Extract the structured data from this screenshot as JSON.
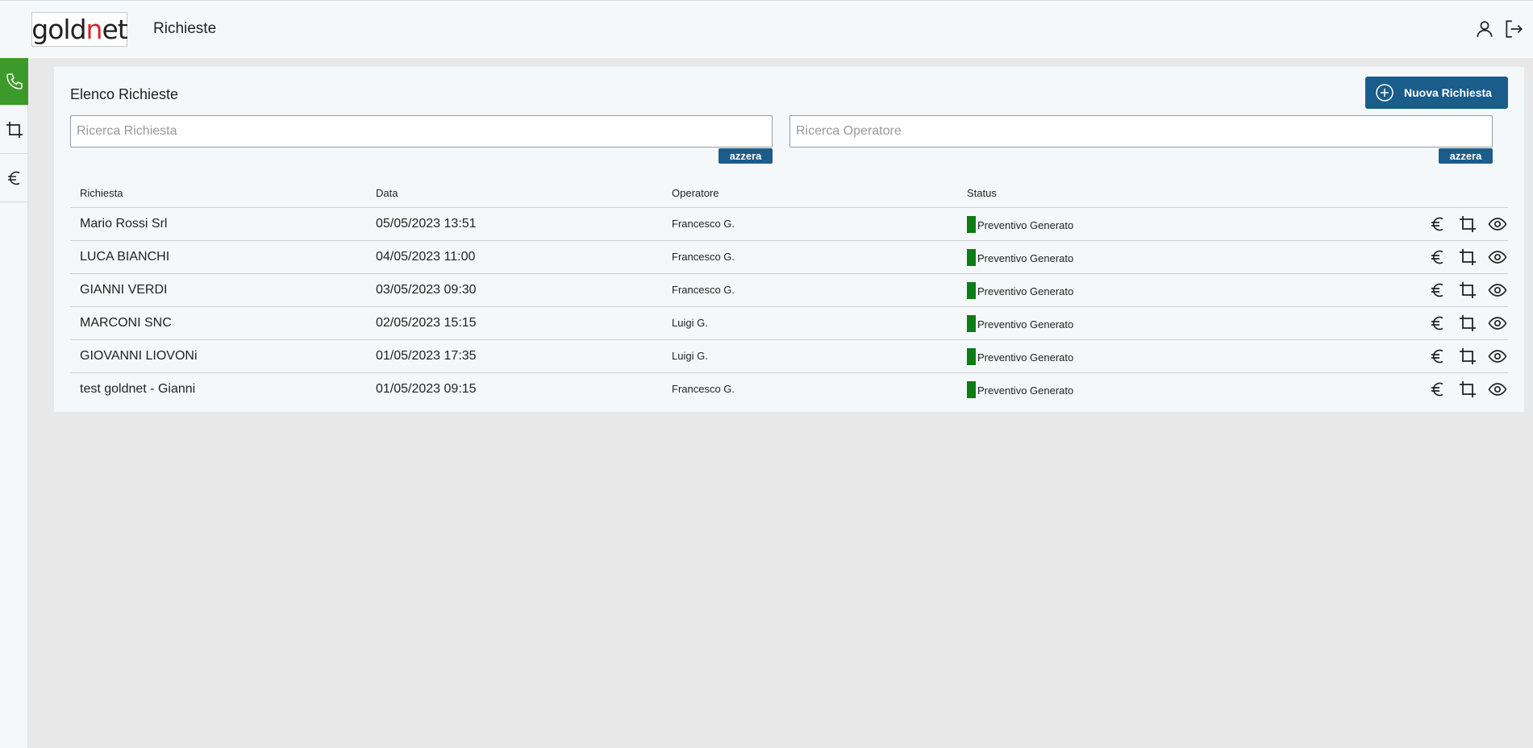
{
  "header": {
    "logo_text_start": "gold",
    "logo_text_accent": "n",
    "logo_text_end": "et",
    "title": "Richieste",
    "icons": [
      "user-icon",
      "logout-icon"
    ]
  },
  "sidebar": {
    "items": [
      {
        "icon": "phone-icon",
        "active": true
      },
      {
        "icon": "crop-icon",
        "active": false
      },
      {
        "icon": "euro-icon",
        "active": false
      }
    ],
    "active_color": "#3c9a2b"
  },
  "main": {
    "title": "Elenco Richieste",
    "new_button_label": "Nuova Richiesta",
    "search_request_placeholder": "Ricerca Richiesta",
    "search_operator_placeholder": "Ricerca Operatore",
    "reset_label": "azzera",
    "accent_color": "#1a5c8a"
  },
  "table": {
    "columns": [
      "Richiesta",
      "Data",
      "Operatore",
      "Status"
    ],
    "rows": [
      {
        "richiesta": "Mario Rossi Srl",
        "data": "05/05/2023 13:51",
        "operatore": "Francesco G.",
        "status": "Preventivo Generato"
      },
      {
        "richiesta": "LUCA BIANCHI",
        "data": "04/05/2023 11:00",
        "operatore": "Francesco G.",
        "status": "Preventivo Generato"
      },
      {
        "richiesta": "GIANNI VERDI",
        "data": "03/05/2023 09:30",
        "operatore": "Francesco G.",
        "status": "Preventivo Generato"
      },
      {
        "richiesta": "MARCONI SNC",
        "data": "02/05/2023 15:15",
        "operatore": "Luigi G.",
        "status": "Preventivo Generato"
      },
      {
        "richiesta": "GIOVANNI LIOVONi",
        "data": "01/05/2023 17:35",
        "operatore": "Luigi G.",
        "status": "Preventivo Generato"
      },
      {
        "richiesta": "test goldnet - Gianni",
        "data": "01/05/2023 09:15",
        "operatore": "Francesco G.",
        "status": "Preventivo Generato"
      }
    ],
    "row_actions": [
      "euro-icon",
      "crop-icon",
      "eye-icon"
    ],
    "status_color": "#0d7d16"
  }
}
